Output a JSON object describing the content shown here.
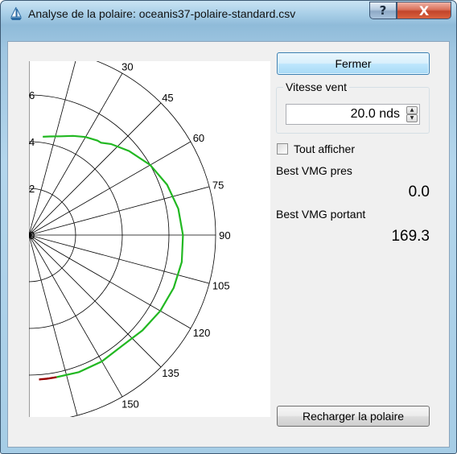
{
  "window": {
    "title": "Analyse de la polaire: oceanis37-polaire-standard.csv",
    "help_glyph": "?",
    "close_glyph": "X",
    "app_icon": "sailboat-icon"
  },
  "buttons": {
    "close_label": "Fermer",
    "reload_label": "Recharger la polaire"
  },
  "wind": {
    "group_title": "Vitesse vent",
    "value": "20.0 nds",
    "up_glyph": "▲",
    "down_glyph": "▼"
  },
  "show_all": {
    "label": "Tout afficher",
    "checked": false
  },
  "vmg": {
    "pres_label": "Best VMG pres",
    "pres_value": "0.0",
    "portant_label": "Best VMG portant",
    "portant_value": "169.3"
  },
  "chart_data": {
    "type": "polar",
    "title": "",
    "radial_ticks": [
      "2",
      "4",
      "6"
    ],
    "angle_ticks": [
      "0",
      "30",
      "45",
      "60",
      "75",
      "90",
      "105",
      "120",
      "135",
      "150"
    ],
    "rmax": 8,
    "colors": {
      "grid": "#000000",
      "curve": "#22b822",
      "highlight": "#990000"
    },
    "series": [
      {
        "color": "#22b822",
        "points": [
          {
            "angle": 8,
            "speed": 4.25
          },
          {
            "angle": 12,
            "speed": 4.32
          },
          {
            "angle": 18,
            "speed": 4.45
          },
          {
            "angle": 24,
            "speed": 4.65
          },
          {
            "angle": 30,
            "speed": 4.85
          },
          {
            "angle": 36,
            "speed": 5.0
          },
          {
            "angle": 38,
            "speed": 5.02
          },
          {
            "angle": 42,
            "speed": 5.25
          },
          {
            "angle": 50,
            "speed": 5.6
          },
          {
            "angle": 60,
            "speed": 6.0
          },
          {
            "angle": 70,
            "speed": 6.3
          },
          {
            "angle": 80,
            "speed": 6.5
          },
          {
            "angle": 90,
            "speed": 6.6
          },
          {
            "angle": 100,
            "speed": 6.65
          },
          {
            "angle": 110,
            "speed": 6.6
          },
          {
            "angle": 120,
            "speed": 6.5
          },
          {
            "angle": 130,
            "speed": 6.35
          },
          {
            "angle": 140,
            "speed": 6.2
          },
          {
            "angle": 150,
            "speed": 6.25
          },
          {
            "angle": 160,
            "speed": 6.25
          },
          {
            "angle": 169,
            "speed": 6.2
          }
        ]
      }
    ],
    "highlight_segment": {
      "angle_start": 169,
      "angle_end": 176,
      "speed": 6.2
    }
  }
}
